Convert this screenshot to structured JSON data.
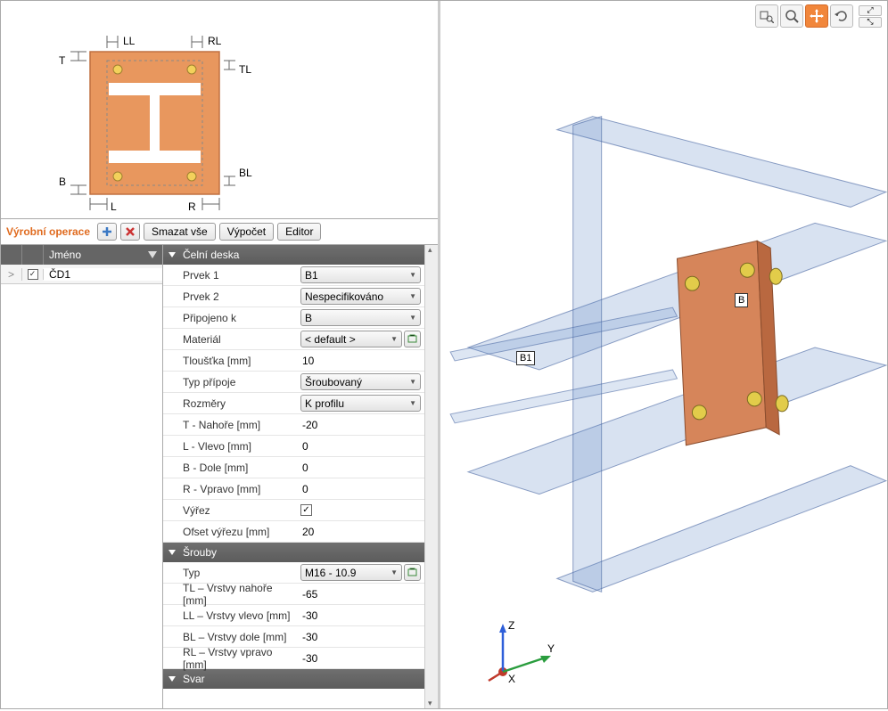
{
  "diagram": {
    "labels": {
      "T": "T",
      "B": "B",
      "L": "L",
      "R": "R",
      "LL": "LL",
      "RL": "RL",
      "TL": "TL",
      "BL": "BL"
    }
  },
  "ops": {
    "title": "Výrobní operace",
    "btn_clear": "Smazat vše",
    "btn_calc": "Výpočet",
    "btn_editor": "Editor"
  },
  "grid": {
    "header_name": "Jméno",
    "row_select_glyph": ">",
    "row_checked": true,
    "row_name": "ČD1"
  },
  "props": {
    "sections": [
      {
        "title": "Čelní deska",
        "rows": [
          {
            "label": "Prvek 1",
            "type": "combo",
            "value": "B1"
          },
          {
            "label": "Prvek 2",
            "type": "combo",
            "value": "Nespecifikováno"
          },
          {
            "label": "Připojeno k",
            "type": "combo",
            "value": "B"
          },
          {
            "label": "Materiál",
            "type": "combo_ext",
            "value": "< default >"
          },
          {
            "label": "Tloušťka [mm]",
            "type": "plain",
            "value": "10"
          },
          {
            "label": "Typ přípoje",
            "type": "combo",
            "value": "Šroubovaný"
          },
          {
            "label": "Rozměry",
            "type": "combo",
            "value": "K profilu"
          },
          {
            "label": "T - Nahoře [mm]",
            "type": "plain",
            "value": "-20"
          },
          {
            "label": "L - Vlevo [mm]",
            "type": "plain",
            "value": "0"
          },
          {
            "label": "B - Dole [mm]",
            "type": "plain",
            "value": "0"
          },
          {
            "label": "R - Vpravo [mm]",
            "type": "plain",
            "value": "0"
          },
          {
            "label": "Výřez",
            "type": "check",
            "value": true
          },
          {
            "label": "Ofset výřezu [mm]",
            "type": "plain",
            "value": "20"
          }
        ]
      },
      {
        "title": "Šrouby",
        "rows": [
          {
            "label": "Typ",
            "type": "combo_ext",
            "value": "M16 - 10.9"
          },
          {
            "label": "TL – Vrstvy nahoře [mm]",
            "type": "plain",
            "value": "-65"
          },
          {
            "label": "LL – Vrstvy vlevo [mm]",
            "type": "plain",
            "value": "-30"
          },
          {
            "label": "BL – Vrstvy dole [mm]",
            "type": "plain",
            "value": "-30"
          },
          {
            "label": "RL – Vrstvy vpravo [mm]",
            "type": "plain",
            "value": "-30"
          }
        ]
      },
      {
        "title": "Svar",
        "rows": []
      }
    ]
  },
  "viewport": {
    "labels": {
      "B": "B",
      "B1": "B1"
    },
    "axes": {
      "x": "X",
      "y": "Y",
      "z": "Z"
    }
  }
}
